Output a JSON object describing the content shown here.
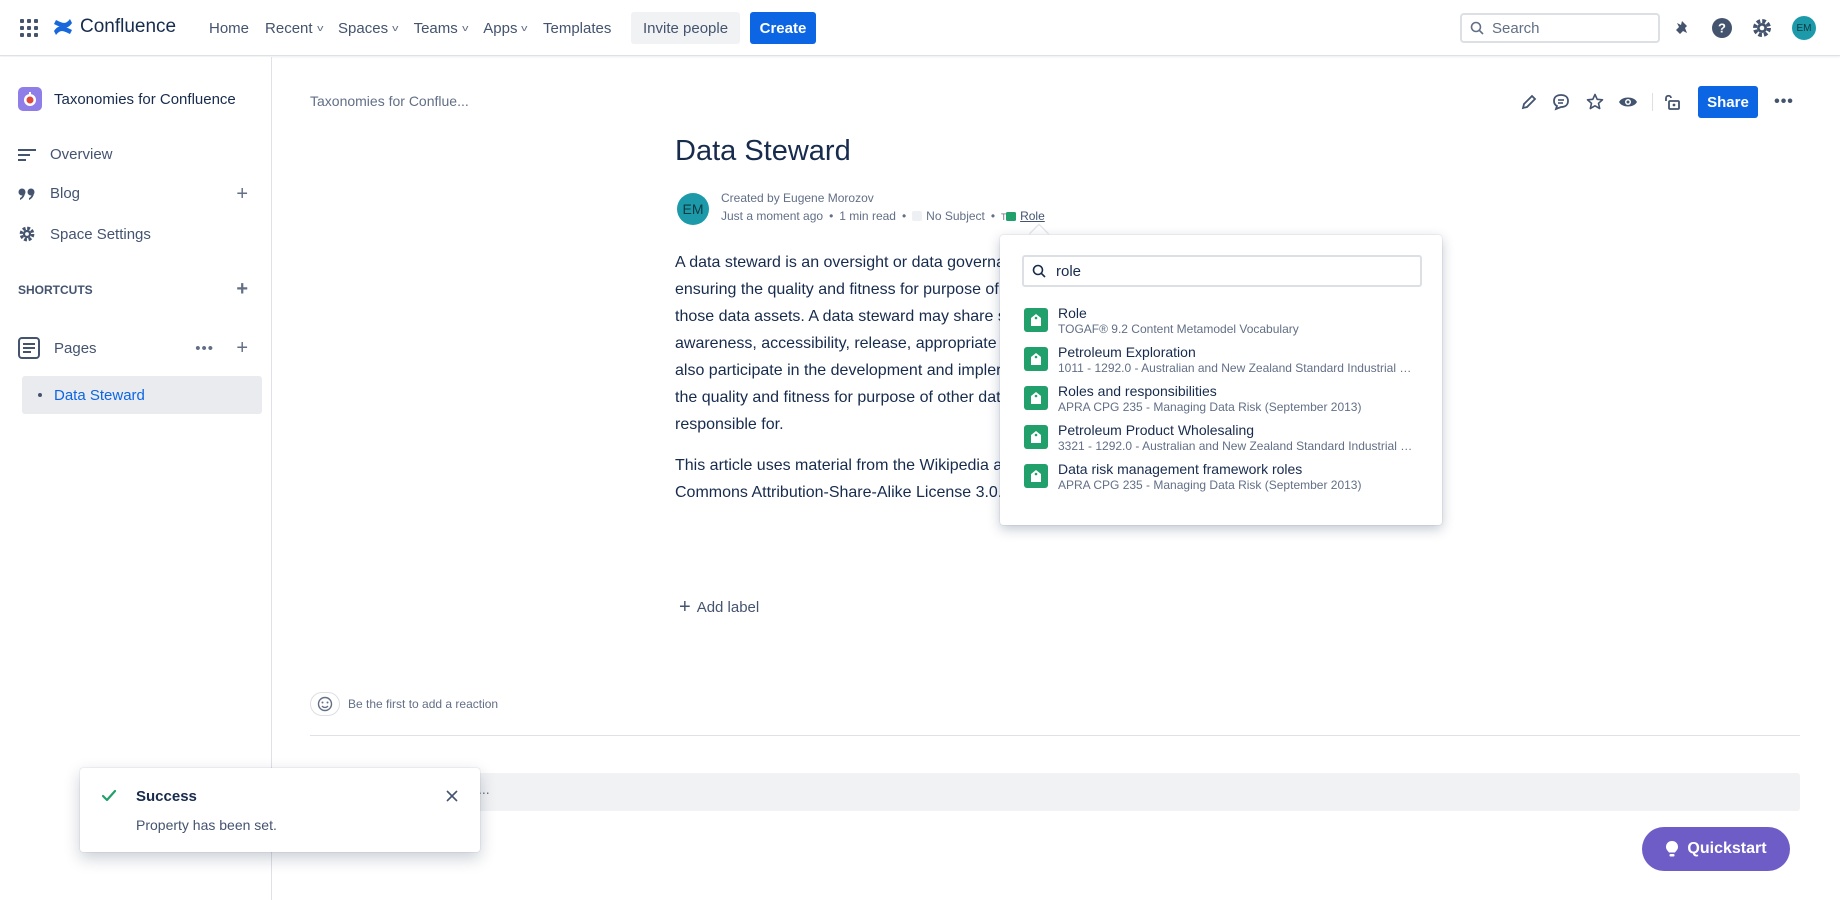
{
  "topbar": {
    "app_name": "Confluence",
    "nav": [
      {
        "label": "Home",
        "dropdown": false
      },
      {
        "label": "Recent",
        "dropdown": true
      },
      {
        "label": "Spaces",
        "dropdown": true
      },
      {
        "label": "Teams",
        "dropdown": true
      },
      {
        "label": "Apps",
        "dropdown": true
      },
      {
        "label": "Templates",
        "dropdown": false
      }
    ],
    "invite_label": "Invite people",
    "create_label": "Create",
    "search_placeholder": "Search",
    "user_initials": "EM"
  },
  "sidebar": {
    "space_name": "Taxonomies for Confluence",
    "items": [
      {
        "label": "Overview"
      },
      {
        "label": "Blog"
      },
      {
        "label": "Space Settings"
      }
    ],
    "shortcuts_label": "SHORTCUTS",
    "pages_label": "Pages",
    "tree": [
      {
        "label": "Data Steward"
      }
    ]
  },
  "page": {
    "breadcrumb": "Taxonomies for Conflue...",
    "share_label": "Share",
    "title": "Data Steward",
    "author_initials": "EM",
    "created_by": "Created by Eugene Morozov",
    "time": "Just a moment ago",
    "read_time": "1 min read",
    "subject": "No Subject",
    "role": "Role",
    "body_lines": [
      "A data steward is an oversight or data governa",
      "ensuring the quality and fitness for purpose of",
      "those data assets. A data steward may share so",
      "awareness, accessibility, release, appropriate us",
      "also participate in the development and impler",
      "the quality and fitness for purpose of other dat",
      "responsible for."
    ],
    "body2_lines": [
      "This article uses material from the Wikipedia ar",
      "Commons Attribution-Share-Alike License 3.0."
    ],
    "add_label": "Add label",
    "reaction_text": "Be the first to add a reaction",
    "comment_stub": "..."
  },
  "popup": {
    "search_value": "role",
    "results": [
      {
        "title": "Role",
        "subtitle": "TOGAF® 9.2 Content Metamodel Vocabulary"
      },
      {
        "title": "Petroleum Exploration",
        "subtitle": "1011 - 1292.0 - Australian and New Zealand Standard Industrial Cl..."
      },
      {
        "title": "Roles and responsibilities",
        "subtitle": "APRA CPG 235 - Managing Data Risk (September 2013)"
      },
      {
        "title": "Petroleum Product Wholesaling",
        "subtitle": "3321 - 1292.0 - Australian and New Zealand Standard Industrial Cl..."
      },
      {
        "title": "Data risk management framework roles",
        "subtitle": "APRA CPG 235 - Managing Data Risk (September 2013)"
      }
    ]
  },
  "toast": {
    "title": "Success",
    "message": "Property has been set."
  },
  "quickstart_label": "Quickstart",
  "colors": {
    "brand_blue": "#0c66e4",
    "tag_green": "#22a06b",
    "quickstart_purple": "#6e5dc6",
    "avatar_teal": "#1d9aaa"
  }
}
